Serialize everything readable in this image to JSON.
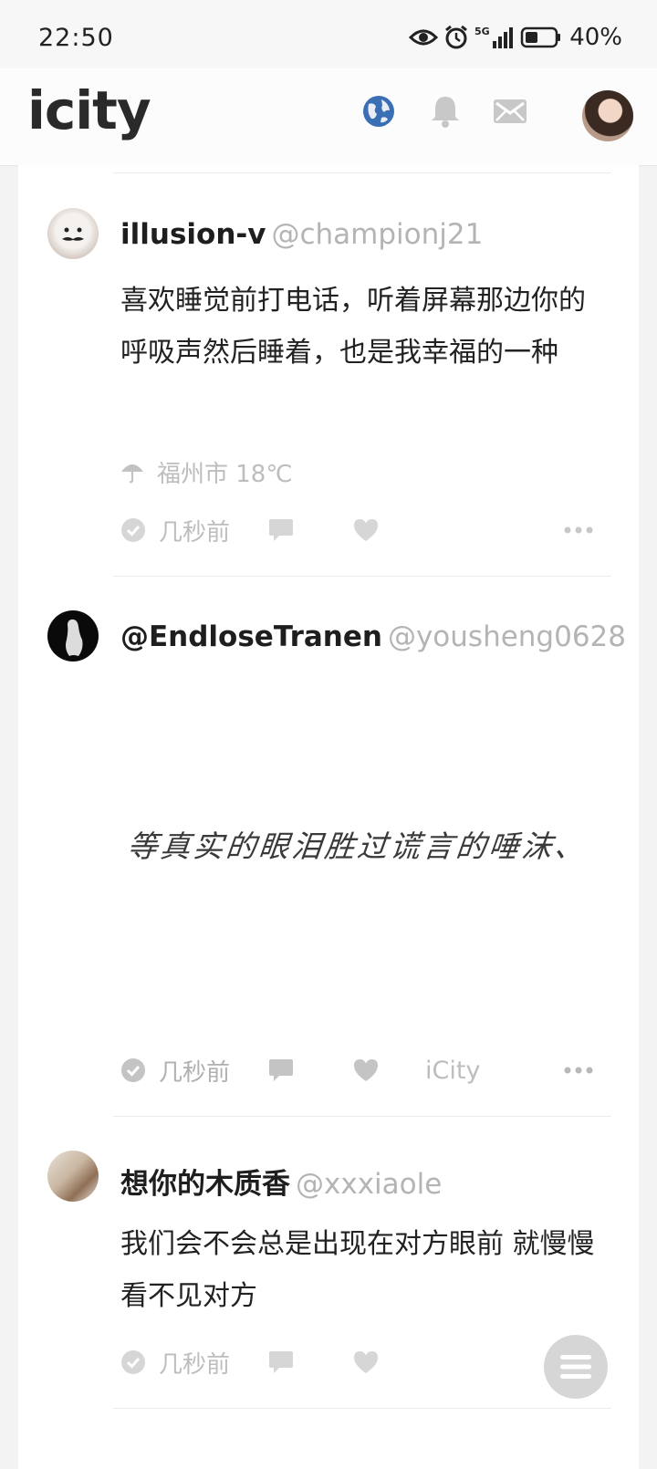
{
  "status_bar": {
    "time": "22:50",
    "network": "5G",
    "battery": "40%"
  },
  "app": {
    "logo": "icity"
  },
  "nav": {
    "icons": [
      "globe-icon",
      "bell-icon",
      "mail-icon"
    ]
  },
  "posts": [
    {
      "username": "illusion-v",
      "handle": "@championj21",
      "text": "喜欢睡觉前打电话，听着屏幕那边你的呼吸声然后睡着，也是我幸福的一种",
      "weather_location": "福州市 18℃",
      "time": "几秒前"
    },
    {
      "username": "@EndloseTranen",
      "handle": "@yousheng0628",
      "image_text": "等真实的眼泪胜过谎言的唾沫、",
      "time": "几秒前",
      "source": "iCity"
    },
    {
      "username": "想你的木质香",
      "handle": "@xxxiaole",
      "text": "我们会不会总是出现在对方眼前 就慢慢看不见对方",
      "time": "几秒前"
    }
  ],
  "colors": {
    "accent": "#3a6fb5",
    "muted": "#bdbdbd",
    "text": "#222222"
  }
}
